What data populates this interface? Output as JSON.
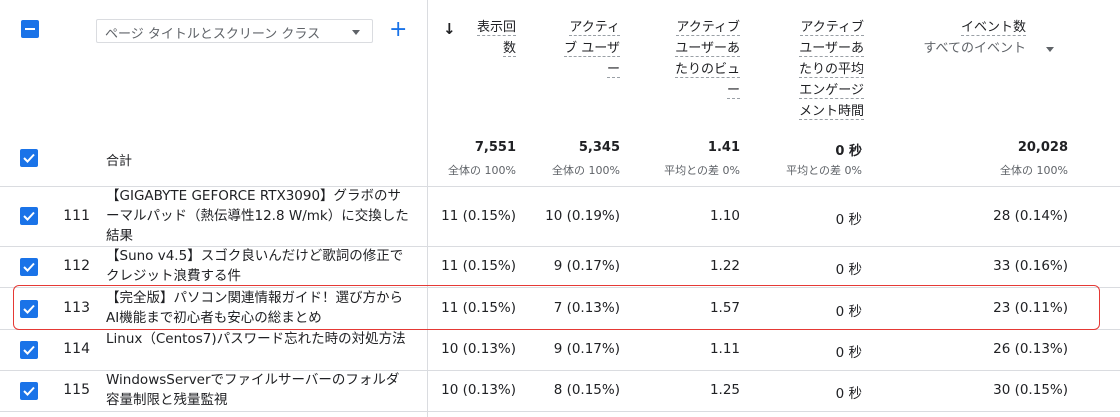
{
  "header": {
    "dimension_select": "ページ タイトルとスクリーン クラス",
    "plus": "+",
    "sort": "↓",
    "metrics": [
      {
        "lines": [
          "表示回",
          "数"
        ]
      },
      {
        "lines": [
          "アクティ",
          "ブ ユーザ",
          "ー"
        ]
      },
      {
        "lines": [
          "アクティブ",
          "ユーザーあ",
          "たりのビュ",
          "ー"
        ]
      },
      {
        "lines": [
          "アクティブ",
          "ユーザーあ",
          "たりの平均",
          "エンゲージ",
          "メント時間"
        ]
      },
      {
        "title": "イベント数",
        "sub": "すべてのイベント"
      }
    ]
  },
  "total": {
    "label": "合計",
    "values": [
      "7,551",
      "5,345",
      "1.41",
      "0 秒",
      "20,028"
    ],
    "subs": [
      "全体の 100%",
      "全体の 100%",
      "平均との差 0%",
      "平均との差 0%",
      "全体の 100%"
    ]
  },
  "rows": [
    {
      "index": "111",
      "title": "【GIGABYTE GEFORCE RTX3090】グラボのサーマルパッド（熱伝導性12.8 W/mk）に交換した結果",
      "cells": [
        "11 (0.15%)",
        "10 (0.19%)",
        "1.10",
        "0 秒",
        "28 (0.14%)"
      ]
    },
    {
      "index": "112",
      "title": "【Suno v4.5】スゴク良いんだけど歌詞の修正でクレジット浪費する件",
      "cells": [
        "11 (0.15%)",
        "9 (0.17%)",
        "1.22",
        "0 秒",
        "33 (0.16%)"
      ]
    },
    {
      "index": "113",
      "title": "【完全版】パソコン関連情報ガイド！選び方からAI機能まで初心者も安心の総まとめ",
      "cells": [
        "11 (0.15%)",
        "7 (0.13%)",
        "1.57",
        "0 秒",
        "23 (0.11%)"
      ]
    },
    {
      "index": "114",
      "title": "Linux（Centos7)パスワード忘れた時の対処方法",
      "cells": [
        "10 (0.13%)",
        "9 (0.17%)",
        "1.11",
        "0 秒",
        "26 (0.13%)"
      ]
    },
    {
      "index": "115",
      "title": "WindowsServerでファイルサーバーのフォルダ容量制限と残量監視",
      "cells": [
        "10 (0.13%)",
        "8 (0.15%)",
        "1.25",
        "0 秒",
        "30 (0.15%)"
      ]
    }
  ],
  "colors": {
    "accent": "#1a73e8",
    "highlight": "#e53935"
  }
}
